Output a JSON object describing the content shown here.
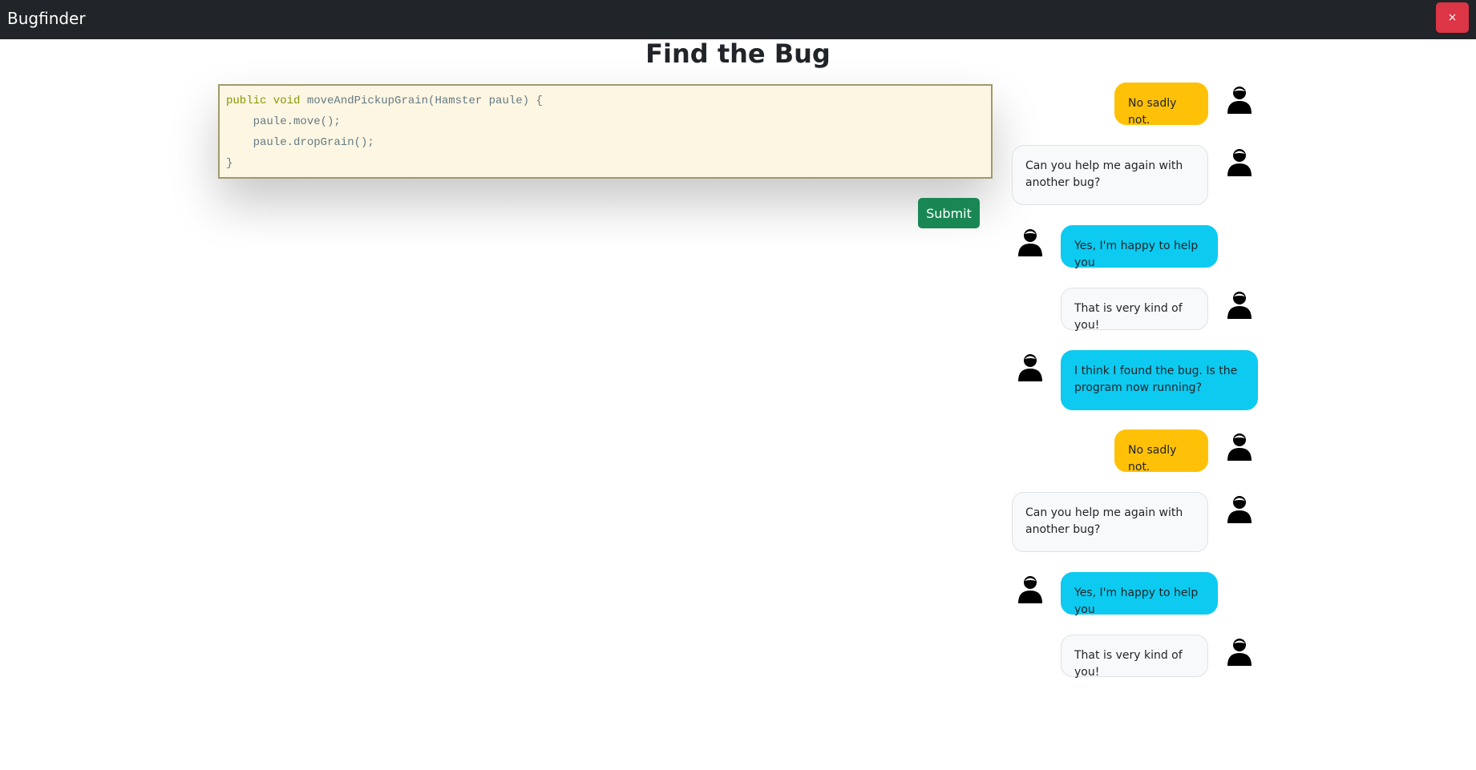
{
  "app": {
    "brand": "Bugfinder",
    "close_label": "×"
  },
  "main": {
    "title": "Find the Bug",
    "submit_label": "Submit"
  },
  "code": {
    "lines": [
      {
        "keyword": "public void",
        "rest": " moveAndPickupGrain(Hamster paule) {"
      },
      {
        "keyword": "",
        "rest": "    paule.move();"
      },
      {
        "keyword": "",
        "rest": "    paule.dropGrain();"
      },
      {
        "keyword": "",
        "rest": "}"
      }
    ]
  },
  "chat": {
    "messages": [
      {
        "text": "No sadly not.",
        "style": "warn",
        "side": "right",
        "avatar": "person-icon"
      },
      {
        "text": "Can you help me again with another bug?",
        "style": "light",
        "side": "right",
        "avatar": "person-icon"
      },
      {
        "text": "Yes, I'm happy to help you",
        "style": "info",
        "side": "left",
        "avatar": "person-icon"
      },
      {
        "text": "That is very kind of you!",
        "style": "light",
        "side": "right",
        "avatar": "person-icon"
      },
      {
        "text": "I think I found the bug. Is the program now running?",
        "style": "info",
        "side": "left",
        "avatar": "person-icon"
      },
      {
        "text": "No sadly not.",
        "style": "warn",
        "side": "right",
        "avatar": "person-icon"
      },
      {
        "text": "Can you help me again with another bug?",
        "style": "light",
        "side": "right",
        "avatar": "person-icon"
      },
      {
        "text": "Yes, I'm happy to help you",
        "style": "info",
        "side": "left",
        "avatar": "person-icon"
      },
      {
        "text": "That is very kind of you!",
        "style": "light",
        "side": "right",
        "avatar": "person-icon"
      }
    ]
  },
  "colors": {
    "navbar": "#212529",
    "close": "#dc3545",
    "submit": "#198754",
    "warn": "#ffc107",
    "info": "#0dcaf0",
    "editor_bg": "#fdf6e3"
  }
}
